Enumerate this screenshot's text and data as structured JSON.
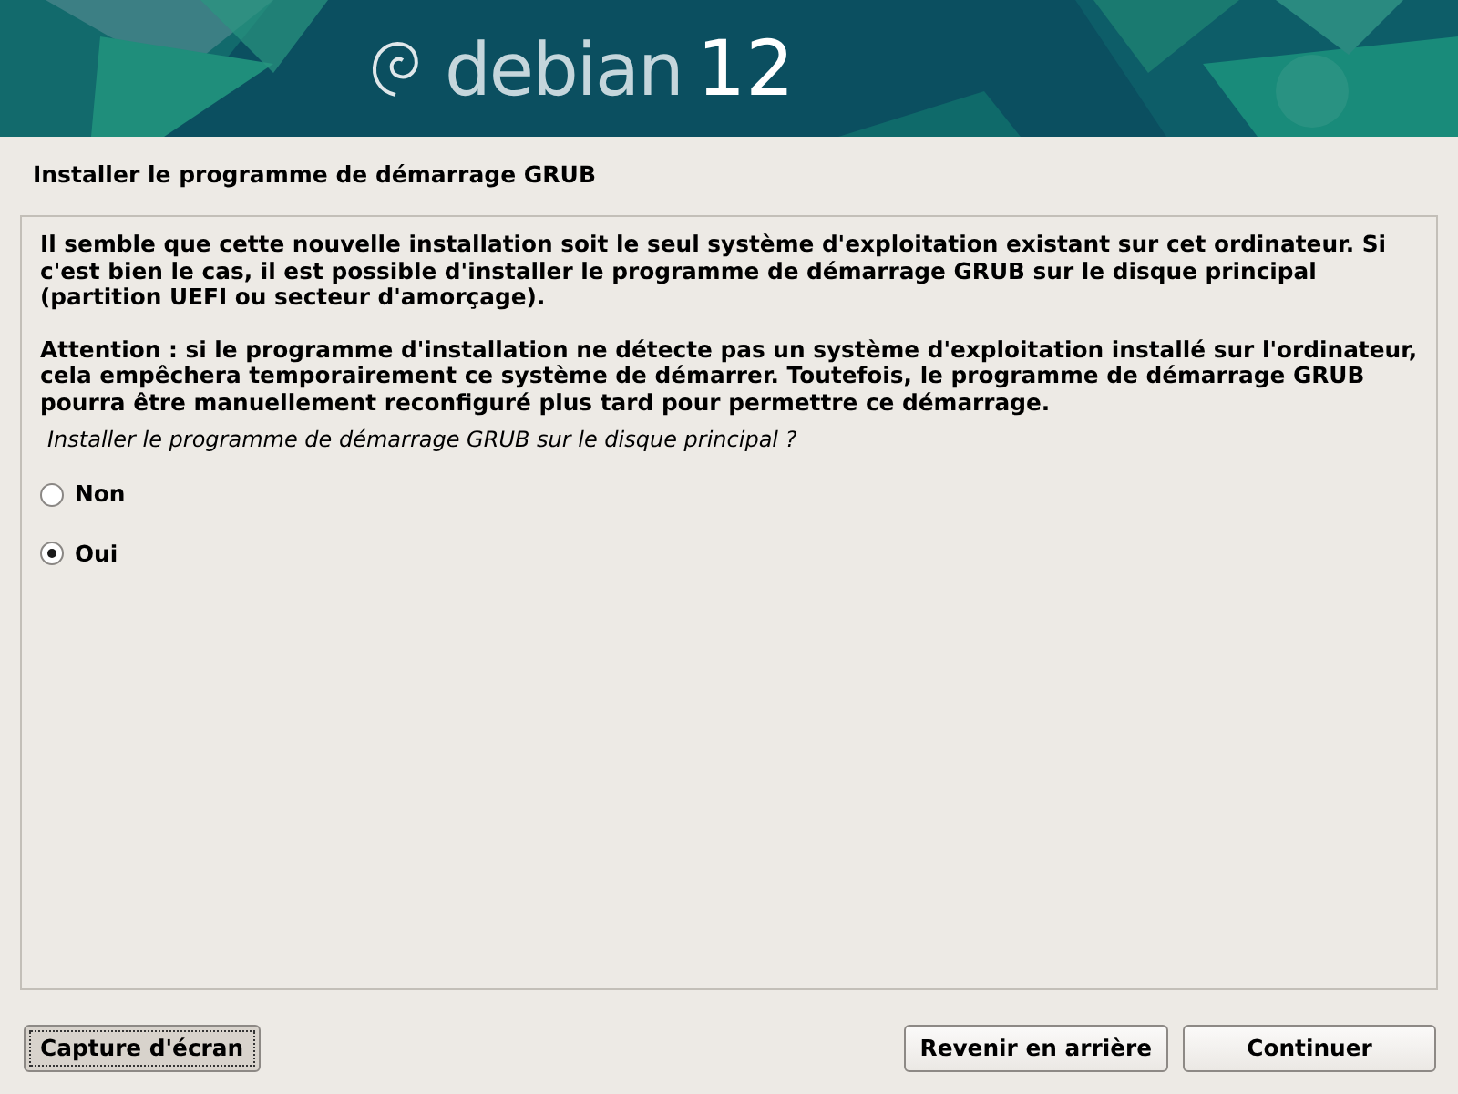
{
  "banner": {
    "brand": "debian",
    "version": "12"
  },
  "title": "Installer le programme de démarrage GRUB",
  "paragraphs": [
    "Il semble que cette nouvelle installation soit le seul système d'exploitation existant sur cet ordinateur. Si c'est bien le cas, il est possible d'installer le programme de démarrage GRUB sur le disque principal (partition UEFI ou secteur d'amorçage).",
    "Attention : si le programme d'installation ne détecte pas un système d'exploitation installé sur l'ordinateur, cela empêchera temporairement ce système de démarrer. Toutefois, le programme de démarrage GRUB pourra être manuellement reconfiguré plus tard pour permettre ce démarrage."
  ],
  "question": "Installer le programme de démarrage GRUB sur le disque principal ?",
  "options": [
    {
      "label": "Non",
      "selected": false
    },
    {
      "label": "Oui",
      "selected": true
    }
  ],
  "left_buttons": [
    "Capture d'écran"
  ],
  "right_buttons": [
    "Revenir en arrière",
    "Continuer"
  ]
}
